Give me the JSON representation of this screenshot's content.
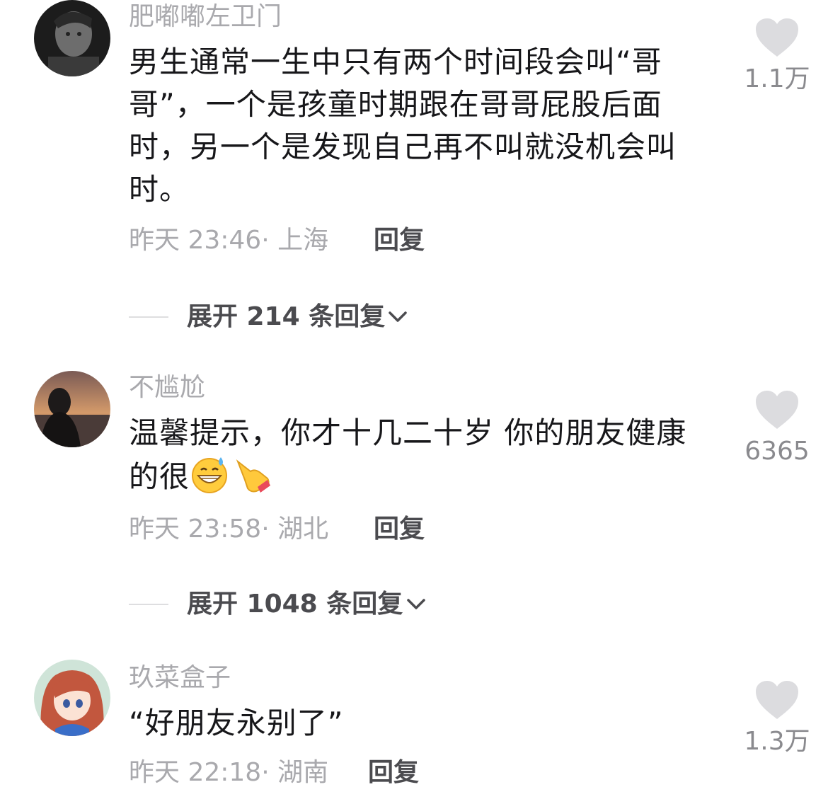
{
  "comments": [
    {
      "username": "肥嘟嘟左卫门",
      "text": "男生通常一生中只有两个时间段会叫“哥哥”，一个是孩童时期跟在哥哥屁股后面时，另一个是发现自己再不叫就没机会叫时。",
      "meta": "昨天 23:46· 上海",
      "reply_label": "回复",
      "likes": "1.1万",
      "expand_label": "展开 214 条回复"
    },
    {
      "username": "不尴尬",
      "text": "温馨提示，你才十几二十岁  你的朋友健康的很",
      "emojis": [
        "grinning-sweat-emoji",
        "pointing-hand-emoji"
      ],
      "meta": "昨天 23:58· 湖北",
      "reply_label": "回复",
      "likes": "6365",
      "expand_label": "展开 1048 条回复"
    },
    {
      "username": "玖菜盒子",
      "text": "“好朋友永别了”",
      "meta": "昨天 22:18· 湖南",
      "reply_label": "回复",
      "likes": "1.3万"
    }
  ],
  "icons": {
    "like": "heart-icon",
    "expand": "chevron-down-icon"
  },
  "colors": {
    "text": "#17171a",
    "secondary": "#a9a9ad",
    "heart": "#dcdcdf"
  }
}
